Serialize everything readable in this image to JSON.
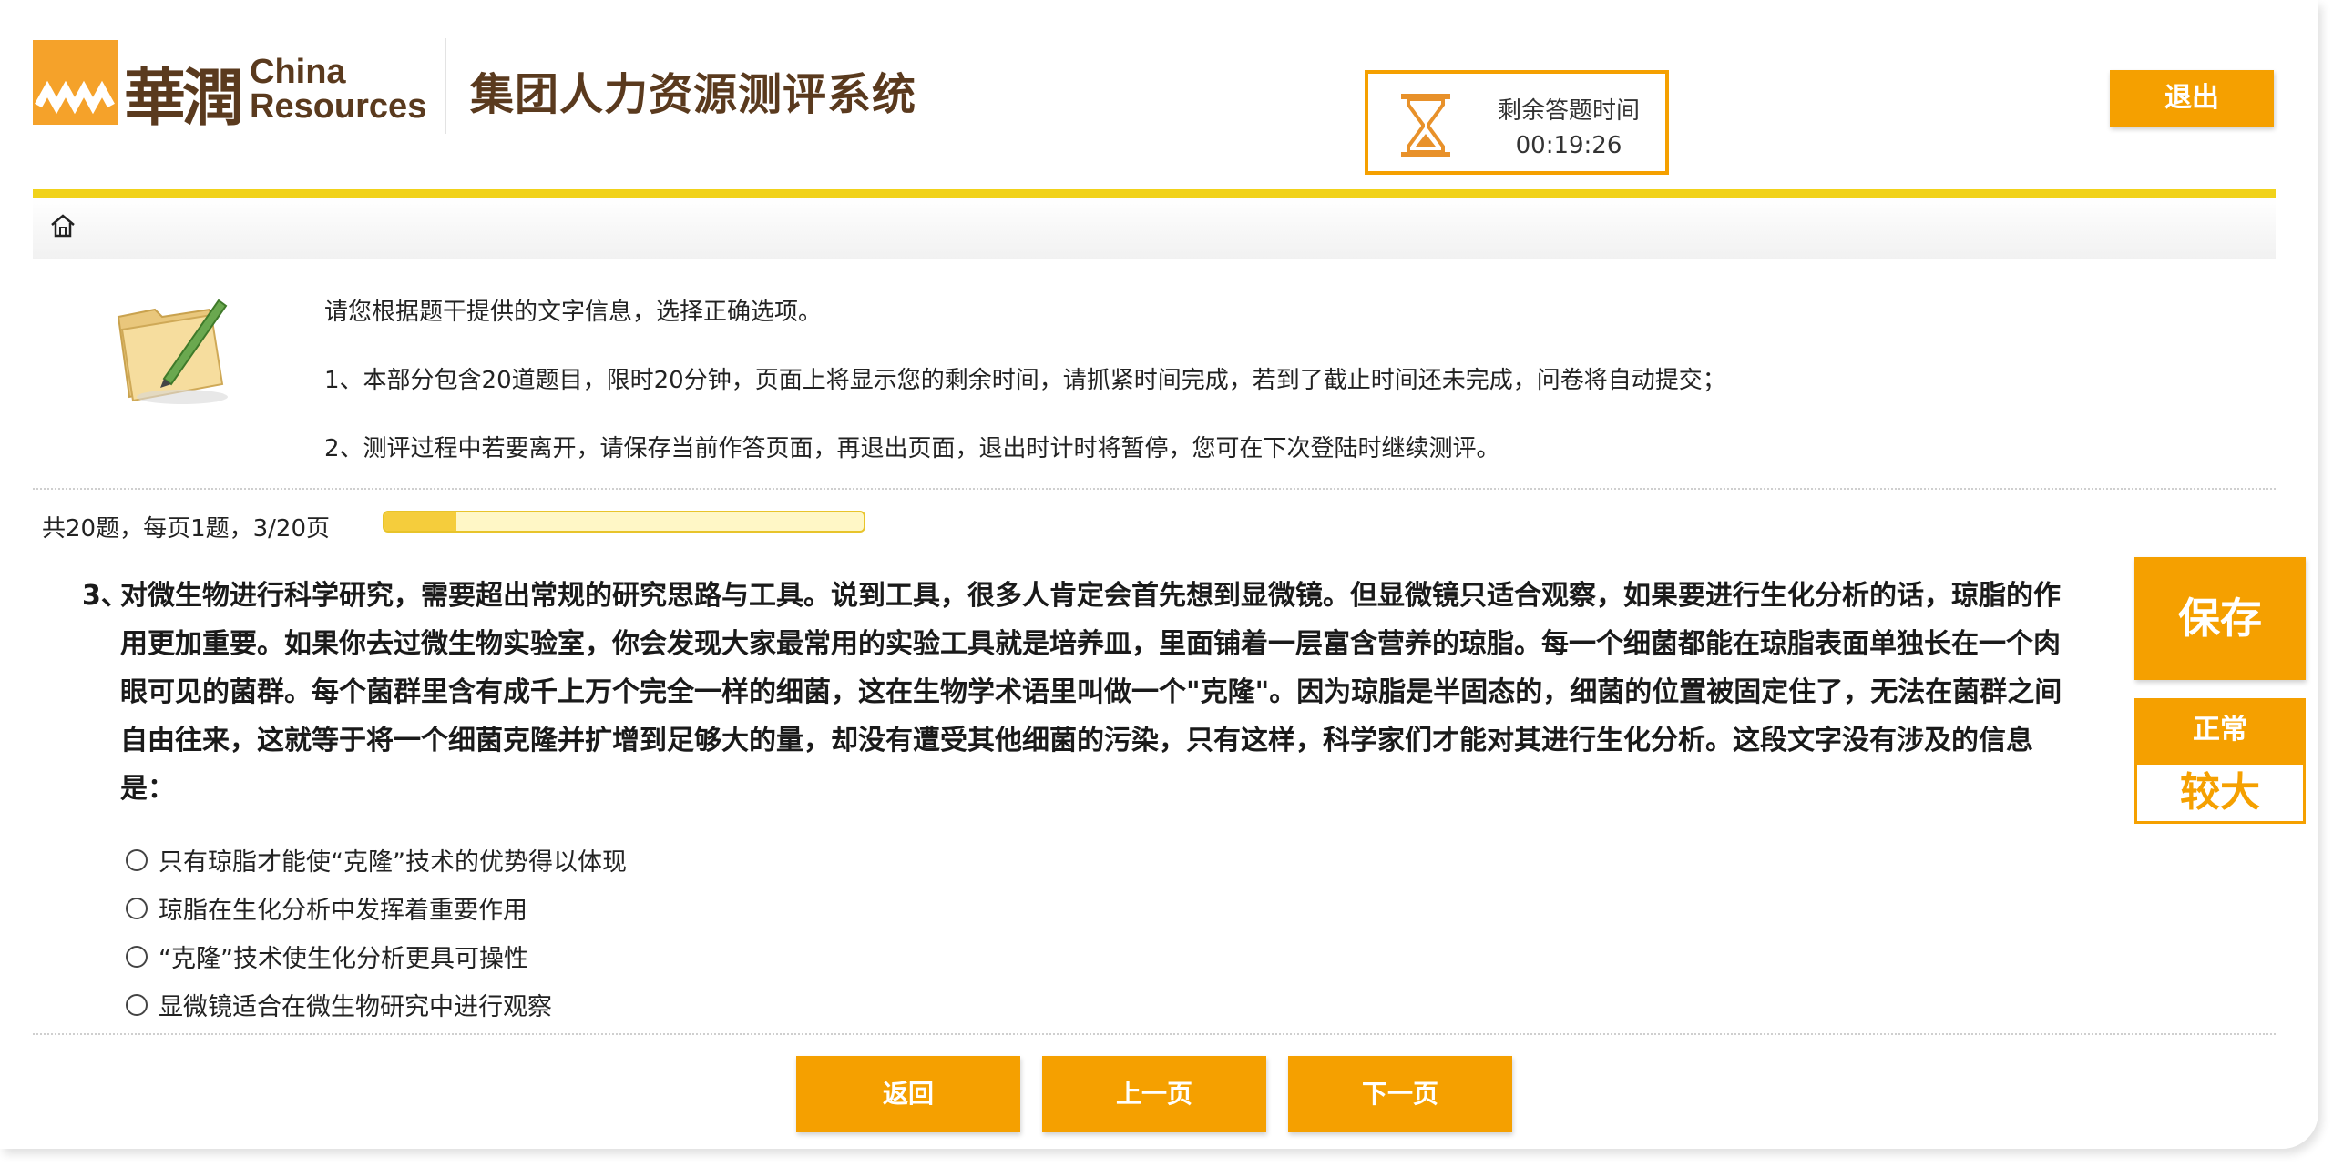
{
  "header": {
    "logo_cn": "華潤",
    "logo_en_line1": "China",
    "logo_en_line2": "Resources",
    "system_title": "集团人力资源测评系统",
    "timer_label": "剩余答题时间",
    "timer_value": "00:19:26",
    "logout_label": "退出",
    "icons": [
      "home-icon",
      "hourglass-icon",
      "folder-pen-icon"
    ]
  },
  "instructions": {
    "intro": "请您根据题干提供的文字信息，选择正确选项。",
    "rule1": "1、本部分包含20道题目，限时20分钟，页面上将显示您的剩余时间，请抓紧时间完成，若到了截止时间还未完成，问卷将自动提交；",
    "rule2": "2、测评过程中若要离开，请保存当前作答页面，再退出页面，退出时计时将暂停，您可在下次登陆时继续测评。"
  },
  "progress": {
    "text": "共20题，每页1题，3/20页",
    "current": 3,
    "total": 20
  },
  "question": {
    "number": "3、",
    "text": "对微生物进行科学研究，需要超出常规的研究思路与工具。说到工具，很多人肯定会首先想到显微镜。但显微镜只适合观察，如果要进行生化分析的话，琼脂的作用更加重要。如果你去过微生物实验室，你会发现大家最常用的实验工具就是培养皿，里面铺着一层富含营养的琼脂。每一个细菌都能在琼脂表面单独长在一个肉眼可见的菌群。每个菌群里含有成千上万个完全一样的细菌，这在生物学术语里叫做一个\"克隆\"。因为琼脂是半固态的，细菌的位置被固定住了，无法在菌群之间自由往来，这就等于将一个细菌克隆并扩增到足够大的量，却没有遭受其他细菌的污染，只有这样，科学家们才能对其进行生化分析。这段文字没有涉及的信息是：",
    "options": [
      "只有琼脂才能使“克隆”技术的优势得以体现",
      "琼脂在生化分析中发挥着重要作用",
      "“克隆”技术使生化分析更具可操性",
      "显微镜适合在微生物研究中进行观察"
    ]
  },
  "side_panel": {
    "save_label": "保存",
    "font_normal_label": "正常",
    "font_large_label": "较大"
  },
  "footer": {
    "back_label": "返回",
    "prev_label": "上一页",
    "next_label": "下一页"
  },
  "colors": {
    "accent": "#f5a000",
    "brand_brown": "#5a3a1e",
    "rule_yellow": "#f1d21a"
  }
}
